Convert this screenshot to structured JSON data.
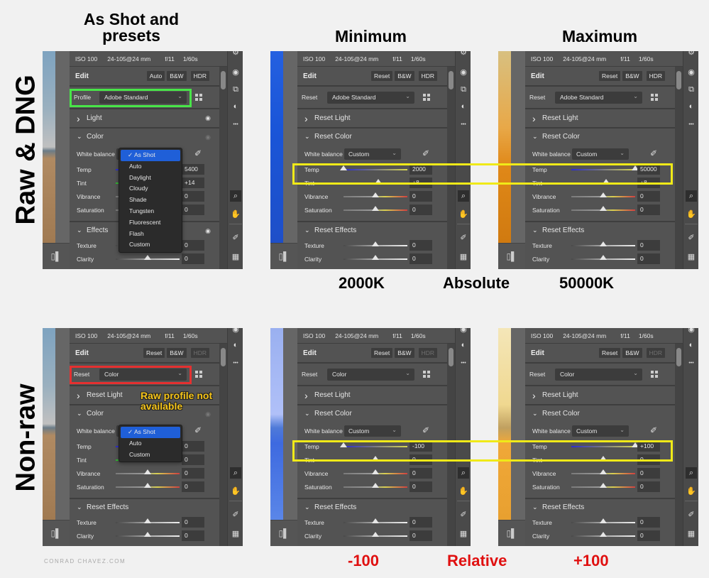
{
  "headings": {
    "col1": "As Shot and presets",
    "col2": "Minimum",
    "col3": "Maximum"
  },
  "row_labels": {
    "raw": "Raw & DNG",
    "nonraw": "Non-raw"
  },
  "captions": {
    "raw_min": "2000K",
    "raw_mode": "Absolute",
    "raw_max": "50000K",
    "nonraw_min": "-100",
    "nonraw_mode": "Relative",
    "nonraw_max": "+100"
  },
  "annotation": "Raw profile not available",
  "credit": "CONRAD CHAVEZ.COM",
  "colors": {
    "raw_highlight": "#48e548",
    "nonraw_highlight": "#e53030",
    "temp_highlight": "#f0ea18",
    "caption_red": "#e01010",
    "selected_menu_item": "#1f5fd8"
  },
  "meta": {
    "iso": "ISO 100",
    "lens": "24-105@24 mm",
    "aperture": "f/11",
    "shutter": "1/60s"
  },
  "panels": [
    {
      "id": "raw-asshot",
      "edit_title": "Edit",
      "buttons": [
        "Auto",
        "B&W",
        "HDR"
      ],
      "hdr_enabled": true,
      "profile_label": "Profile",
      "profile_value": "Adobe Standard",
      "light_label": "Light",
      "color_label": "Color",
      "effects_label": "Effects",
      "wb_label": "White balance",
      "wb_value": "As Shot",
      "sliders": [
        {
          "label": "Temp",
          "value": "5400",
          "position": 0.5
        },
        {
          "label": "Tint",
          "value": "+14",
          "position": 0.55
        },
        {
          "label": "Vibrance",
          "value": "0",
          "position": 0.5
        },
        {
          "label": "Saturation",
          "value": "0",
          "position": 0.5
        }
      ],
      "effects": [
        {
          "label": "Texture",
          "value": "0",
          "position": 0.5
        },
        {
          "label": "Clarity",
          "value": "0",
          "position": 0.5
        }
      ],
      "menu": [
        "As Shot",
        "Auto",
        "Daylight",
        "Cloudy",
        "Shade",
        "Tungsten",
        "Fluorescent",
        "Flash",
        "Custom"
      ],
      "menu_selected": "As Shot"
    },
    {
      "id": "raw-min",
      "edit_title": "Edit",
      "buttons": [
        "Reset",
        "B&W",
        "HDR"
      ],
      "hdr_enabled": true,
      "profile_label": "Reset",
      "profile_value": "Adobe Standard",
      "light_label": "Reset Light",
      "color_label": "Reset Color",
      "effects_label": "Reset Effects",
      "wb_label": "White balance",
      "wb_value": "Custom",
      "sliders": [
        {
          "label": "Temp",
          "value": "2000",
          "position": 0.0
        },
        {
          "label": "Tint",
          "value": "+8",
          "position": 0.54
        },
        {
          "label": "Vibrance",
          "value": "0",
          "position": 0.5
        },
        {
          "label": "Saturation",
          "value": "0",
          "position": 0.5
        }
      ],
      "effects": [
        {
          "label": "Texture",
          "value": "0",
          "position": 0.5
        },
        {
          "label": "Clarity",
          "value": "0",
          "position": 0.5
        }
      ]
    },
    {
      "id": "raw-max",
      "edit_title": "Edit",
      "buttons": [
        "Reset",
        "B&W",
        "HDR"
      ],
      "hdr_enabled": true,
      "profile_label": "Reset",
      "profile_value": "Adobe Standard",
      "light_label": "Reset Light",
      "color_label": "Reset Color",
      "effects_label": "Reset Effects",
      "wb_label": "White balance",
      "wb_value": "Custom",
      "sliders": [
        {
          "label": "Temp",
          "value": "50000",
          "position": 1.0
        },
        {
          "label": "Tint",
          "value": "+8",
          "position": 0.54
        },
        {
          "label": "Vibrance",
          "value": "0",
          "position": 0.5
        },
        {
          "label": "Saturation",
          "value": "0",
          "position": 0.5
        }
      ],
      "effects": [
        {
          "label": "Texture",
          "value": "0",
          "position": 0.5
        },
        {
          "label": "Clarity",
          "value": "0",
          "position": 0.5
        }
      ]
    },
    {
      "id": "nonraw-asshot",
      "edit_title": "Edit",
      "buttons": [
        "Reset",
        "B&W",
        "HDR"
      ],
      "hdr_enabled": false,
      "profile_label": "Reset",
      "profile_value": "Color",
      "light_label": "Reset Light",
      "color_label": "Color",
      "effects_label": "Reset Effects",
      "wb_label": "White balance",
      "wb_value": "As Shot",
      "sliders": [
        {
          "label": "Temp",
          "value": "0",
          "position": 0.5
        },
        {
          "label": "Tint",
          "value": "0",
          "position": 0.5
        },
        {
          "label": "Vibrance",
          "value": "0",
          "position": 0.5
        },
        {
          "label": "Saturation",
          "value": "0",
          "position": 0.5
        }
      ],
      "effects": [
        {
          "label": "Texture",
          "value": "0",
          "position": 0.5
        },
        {
          "label": "Clarity",
          "value": "0",
          "position": 0.5
        }
      ],
      "menu": [
        "As Shot",
        "Auto",
        "Custom"
      ],
      "menu_selected": "As Shot"
    },
    {
      "id": "nonraw-min",
      "edit_title": "Edit",
      "buttons": [
        "Reset",
        "B&W",
        "HDR"
      ],
      "hdr_enabled": false,
      "profile_label": "Reset",
      "profile_value": "Color",
      "light_label": "Reset Light",
      "color_label": "Reset Color",
      "effects_label": "Reset Effects",
      "wb_label": "White balance",
      "wb_value": "Custom",
      "sliders": [
        {
          "label": "Temp",
          "value": "-100",
          "position": 0.0
        },
        {
          "label": "Tint",
          "value": "0",
          "position": 0.5
        },
        {
          "label": "Vibrance",
          "value": "0",
          "position": 0.5
        },
        {
          "label": "Saturation",
          "value": "0",
          "position": 0.5
        }
      ],
      "effects": [
        {
          "label": "Texture",
          "value": "0",
          "position": 0.5
        },
        {
          "label": "Clarity",
          "value": "0",
          "position": 0.5
        }
      ]
    },
    {
      "id": "nonraw-max",
      "edit_title": "Edit",
      "buttons": [
        "Reset",
        "B&W",
        "HDR"
      ],
      "hdr_enabled": false,
      "profile_label": "Reset",
      "profile_value": "Color",
      "light_label": "Reset Light",
      "color_label": "Reset Color",
      "effects_label": "Reset Effects",
      "wb_label": "White balance",
      "wb_value": "Custom",
      "sliders": [
        {
          "label": "Temp",
          "value": "+100",
          "position": 1.0
        },
        {
          "label": "Tint",
          "value": "0",
          "position": 0.5
        },
        {
          "label": "Vibrance",
          "value": "0",
          "position": 0.5
        },
        {
          "label": "Saturation",
          "value": "0",
          "position": 0.5
        }
      ],
      "effects": [
        {
          "label": "Texture",
          "value": "0",
          "position": 0.5
        },
        {
          "label": "Clarity",
          "value": "0",
          "position": 0.5
        }
      ]
    }
  ]
}
